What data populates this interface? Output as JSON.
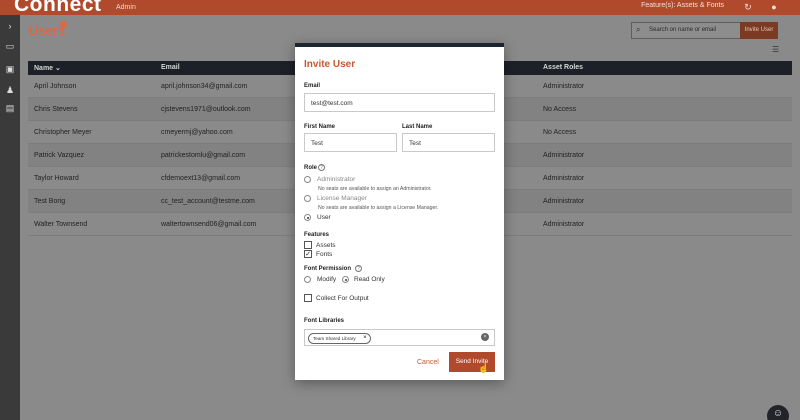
{
  "app": {
    "logo": "Connect",
    "logo_sub": "Admin",
    "features_label": "Feature(s): Assets & Fonts"
  },
  "page": {
    "title": "Users",
    "search_placeholder": "Search on name or email",
    "invite_button": "Invite User"
  },
  "table": {
    "headers": {
      "name": "Name ⌄",
      "email": "Email",
      "asset_roles": "Asset Roles"
    },
    "rows": [
      {
        "name": "April Johnson",
        "email": "april.johnson34@gmail.com",
        "asset_role": "Administrator"
      },
      {
        "name": "Chris Stevens",
        "email": "cjstevens1971@outlook.com",
        "asset_role": "No Access"
      },
      {
        "name": "Christopher Meyer",
        "email": "cmeyermj@yahoo.com",
        "asset_role": "No Access"
      },
      {
        "name": "Patrick Vazquez",
        "email": "patrickestomlu@gmail.com",
        "asset_role": "Administrator"
      },
      {
        "name": "Taylor Howard",
        "email": "cfdemoext13@gmail.com",
        "asset_role": "Administrator"
      },
      {
        "name": "Test Borig",
        "email": "cc_test_account@testme.com",
        "asset_role": "Administrator"
      },
      {
        "name": "Walter Townsend",
        "email": "waltertownsend06@gmail.com",
        "asset_role": "Administrator"
      }
    ]
  },
  "modal": {
    "title": "Invite User",
    "email_label": "Email",
    "email_value": "test@test.com",
    "first_name_label": "First Name",
    "first_name_value": "Test",
    "last_name_label": "Last Name",
    "last_name_value": "Test",
    "role_label": "Role",
    "role_options": [
      {
        "label": "Administrator",
        "note": "No seats are available to assign an Administrator."
      },
      {
        "label": "License Manager",
        "note": "No seats are available to assign a License Manager."
      },
      {
        "label": "User",
        "note": ""
      }
    ],
    "features_label": "Features",
    "features": [
      {
        "label": "Assets",
        "checked": false
      },
      {
        "label": "Fonts",
        "checked": true
      }
    ],
    "font_permission_label": "Font Permission",
    "font_permission_options": [
      "Modify",
      "Read Only"
    ],
    "collect_for_output": "Collect For Output",
    "font_libraries_label": "Font Libraries",
    "library_chip": "Team Shared Library",
    "cancel": "Cancel",
    "send_invite": "Send Invite"
  },
  "colors": {
    "brand": "#b14a2c",
    "accent_text": "#c25a33",
    "dark_header": "#1d2027"
  },
  "icons": {
    "chevron": "chevron-right-icon",
    "help": "question-circle-icon",
    "remove": "close-icon"
  }
}
